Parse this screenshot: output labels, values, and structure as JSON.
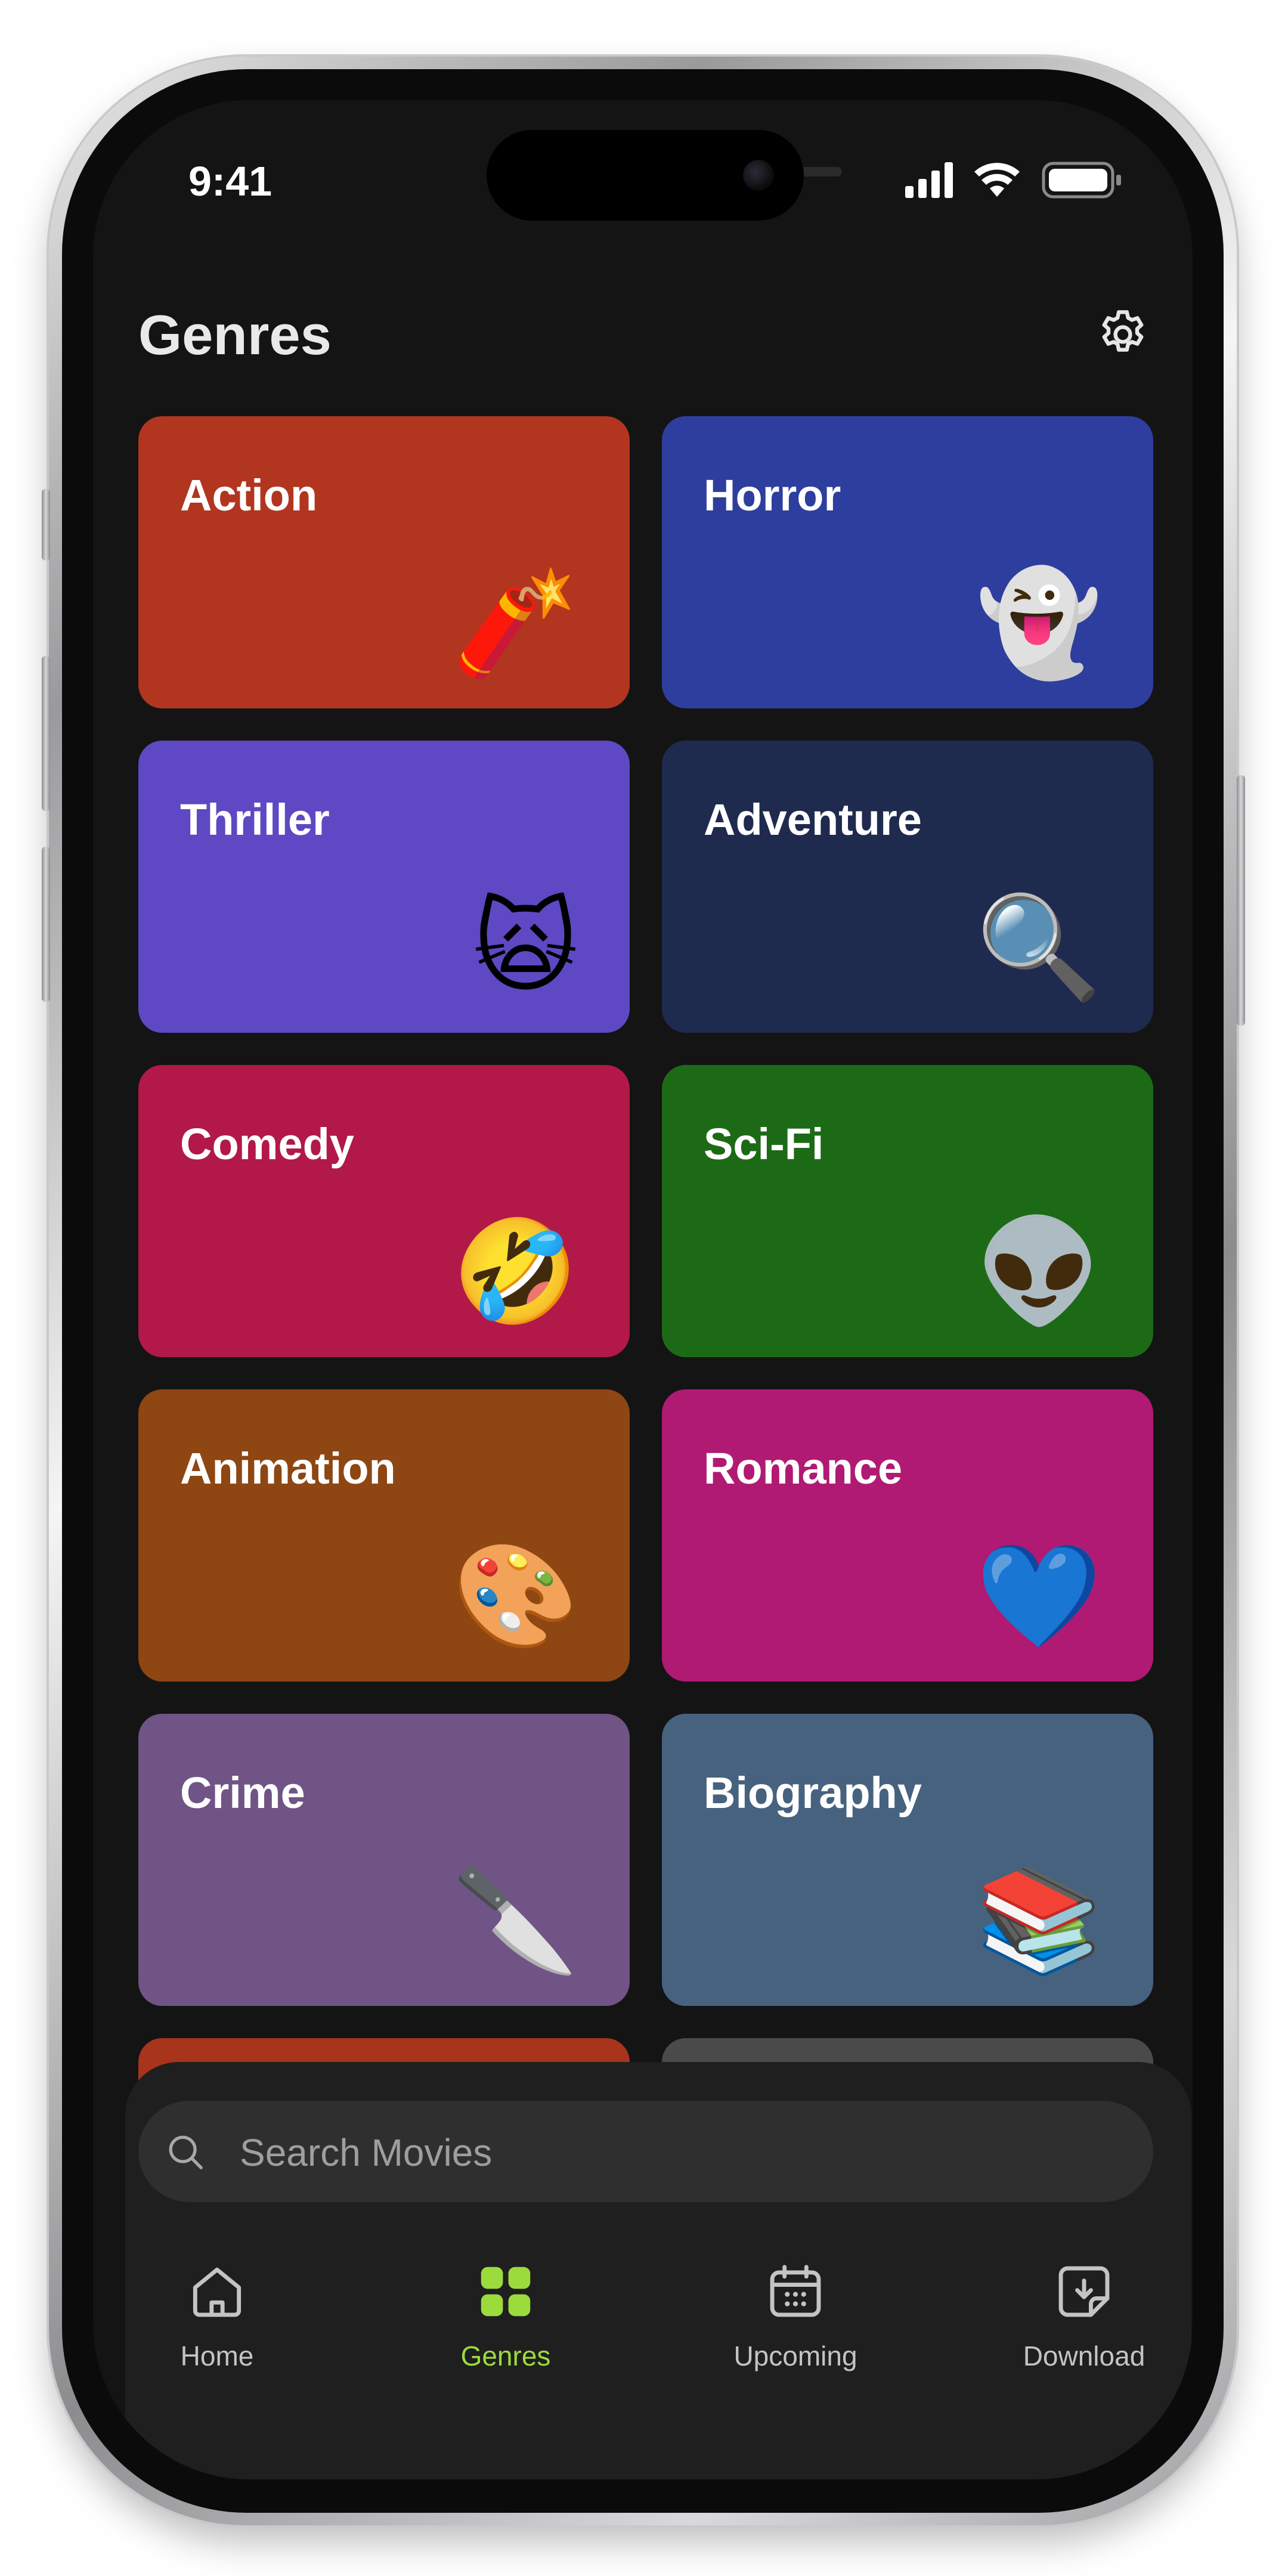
{
  "status_bar": {
    "time": "9:41"
  },
  "header": {
    "title": "Genres"
  },
  "icons": {
    "settings": "gear-icon",
    "search": "search-icon",
    "signal": "cellular-signal-icon",
    "wifi": "wifi-icon",
    "battery": "battery-icon"
  },
  "genres": [
    {
      "label": "Action",
      "emoji": "🧨",
      "color": "#b23520"
    },
    {
      "label": "Horror",
      "emoji": "👻",
      "color": "#2e3e9e"
    },
    {
      "label": "Thriller",
      "emoji": "🙀",
      "color": "#5e48c3"
    },
    {
      "label": "Adventure",
      "emoji": "🔍",
      "color": "#1f2a4f"
    },
    {
      "label": "Comedy",
      "emoji": "🤣",
      "color": "#b21948"
    },
    {
      "label": "Sci-Fi",
      "emoji": "👽",
      "color": "#1d6a16"
    },
    {
      "label": "Animation",
      "emoji": "🎨",
      "color": "#8e4613"
    },
    {
      "label": "Romance",
      "emoji": "💙",
      "color": "#b01a72"
    },
    {
      "label": "Crime",
      "emoji": "🔪",
      "color": "#6f5485"
    },
    {
      "label": "Biography",
      "emoji": "📚",
      "color": "#46627f"
    }
  ],
  "search": {
    "placeholder": "Search Movies"
  },
  "tabs": [
    {
      "label": "Home",
      "icon": "home-icon",
      "active": false
    },
    {
      "label": "Genres",
      "icon": "grid-icon",
      "active": true
    },
    {
      "label": "Upcoming",
      "icon": "calendar-icon",
      "active": false
    },
    {
      "label": "Download",
      "icon": "download-icon",
      "active": false
    }
  ],
  "colors": {
    "accent": "#9bdc3c",
    "background": "#141414",
    "panel": "#1f1f1f",
    "partial_card_left": "#a8341c",
    "partial_card_right": "#4a4a4a"
  }
}
